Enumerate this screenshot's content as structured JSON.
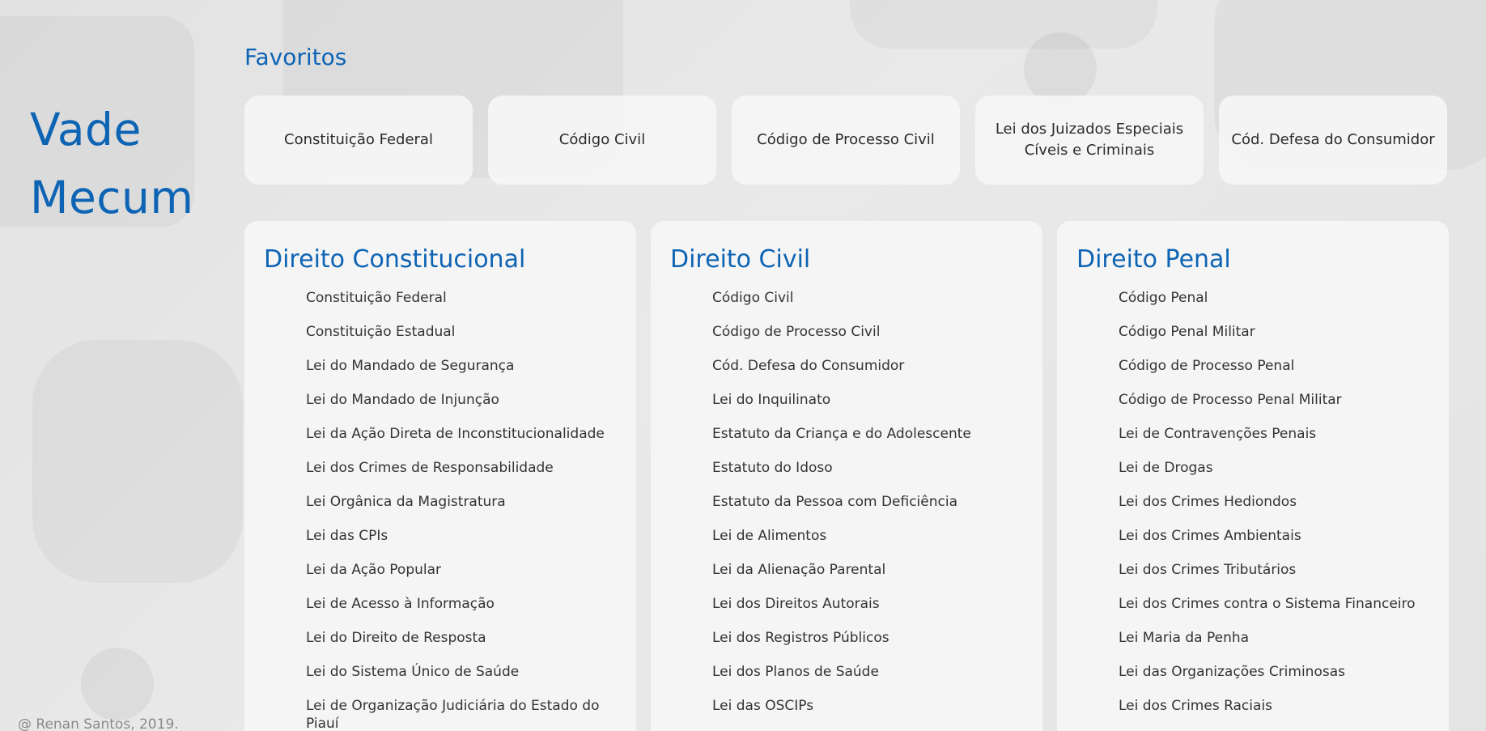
{
  "brand": {
    "line1": "Vade",
    "line2": "Mecum"
  },
  "footer": "@ Renan Santos, 2019.",
  "favorites": {
    "title": "Favoritos",
    "items": [
      "Constituição Federal",
      "Código Civil",
      "Código de Processo Civil",
      "Lei dos Juizados Especiais Cíveis e Criminais",
      "Cód. Defesa do Consumidor"
    ]
  },
  "sections": [
    {
      "title": "Direito Constitucional",
      "items": [
        "Constituição Federal",
        "Constituição Estadual",
        "Lei do Mandado de Segurança",
        "Lei do Mandado de Injunção",
        "Lei da Ação Direta de Inconstitucionalidade",
        "Lei dos Crimes de Responsabilidade",
        "Lei Orgânica da Magistratura",
        "Lei das CPIs",
        "Lei da Ação Popular",
        "Lei de Acesso à Informação",
        "Lei do Direito de Resposta",
        "Lei do Sistema Único de Saúde",
        "Lei de Organização Judiciária do Estado do Piauí"
      ]
    },
    {
      "title": "Direito Civil",
      "items": [
        "Código Civil",
        "Código de Processo Civil",
        "Cód. Defesa do Consumidor",
        "Lei do Inquilinato",
        "Estatuto da Criança e do Adolescente",
        "Estatuto do Idoso",
        "Estatuto da Pessoa com Deficiência",
        "Lei de Alimentos",
        "Lei da Alienação Parental",
        "Lei dos Direitos Autorais",
        "Lei dos Registros Públicos",
        "Lei dos Planos de Saúde",
        "Lei das OSCIPs"
      ]
    },
    {
      "title": "Direito Penal",
      "items": [
        "Código Penal",
        "Código Penal Militar",
        "Código de Processo Penal",
        "Código de Processo Penal Militar",
        "Lei de Contravenções Penais",
        "Lei de Drogas",
        "Lei dos Crimes Hediondos",
        "Lei dos Crimes Ambientais",
        "Lei dos Crimes Tributários",
        "Lei dos Crimes contra o Sistema Financeiro",
        "Lei Maria da Penha",
        "Lei das Organizações Criminosas",
        "Lei dos Crimes Raciais"
      ]
    }
  ]
}
